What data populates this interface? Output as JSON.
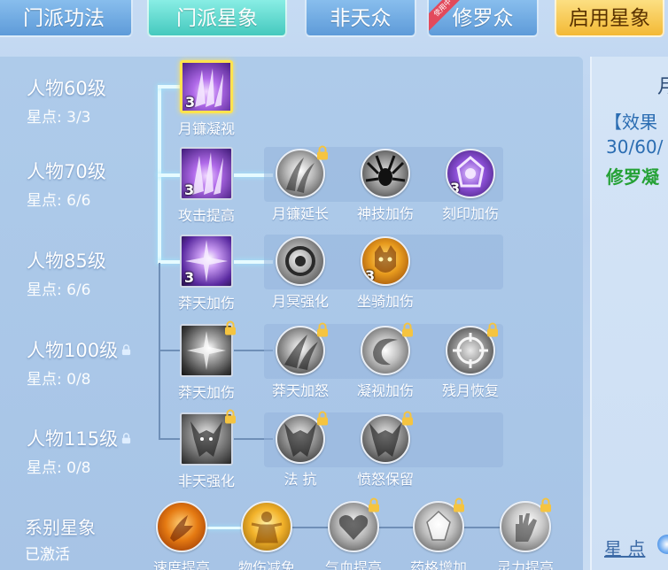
{
  "tabs": [
    {
      "label": "门派功法",
      "state": "normal"
    },
    {
      "label": "门派星象",
      "state": "active"
    },
    {
      "label": "非天众",
      "state": "normal"
    },
    {
      "label": "修罗众",
      "state": "normal",
      "ribbon": "使用中"
    },
    {
      "label": "启用星象",
      "state": "action"
    }
  ],
  "levels": [
    {
      "title": "人物60级",
      "stars": "星点: 3/3",
      "locked": false
    },
    {
      "title": "人物70级",
      "stars": "星点: 6/6",
      "locked": false
    },
    {
      "title": "人物85级",
      "stars": "星点: 6/6",
      "locked": false
    },
    {
      "title": "人物100级",
      "stars": "星点: 0/8",
      "locked": true
    },
    {
      "title": "人物115级",
      "stars": "星点: 0/8",
      "locked": true
    }
  ],
  "skills": {
    "r0": [
      {
        "label": "月镰凝视",
        "level": "3",
        "locked": false,
        "icon": "purple-claw-icon",
        "selected": true
      }
    ],
    "r1": [
      {
        "label": "攻击提高",
        "level": "3",
        "locked": false,
        "icon": "purple-claw-icon"
      },
      {
        "label": "月镰延长",
        "level": "",
        "locked": true,
        "icon": "grey-claw-icon"
      },
      {
        "label": "神技加伤",
        "level": "",
        "locked": false,
        "icon": "grey-spider-icon"
      },
      {
        "label": "刻印加伤",
        "level": "3",
        "locked": false,
        "icon": "purple-seal-icon"
      }
    ],
    "r2": [
      {
        "label": "莽天加伤",
        "level": "3",
        "locked": false,
        "icon": "purple-burst-icon"
      },
      {
        "label": "月冥强化",
        "level": "",
        "locked": false,
        "icon": "grey-moon-icon"
      },
      {
        "label": "坐骑加伤",
        "level": "3",
        "locked": false,
        "icon": "gold-beast-icon"
      }
    ],
    "r3": [
      {
        "label": "莽天加伤",
        "level": "",
        "locked": true,
        "icon": "grey-burst-icon"
      },
      {
        "label": "莽天加怒",
        "level": "",
        "locked": true,
        "icon": "grey-claw-icon"
      },
      {
        "label": "凝视加伤",
        "level": "",
        "locked": true,
        "icon": "grey-swirl-icon"
      },
      {
        "label": "残月恢复",
        "level": "",
        "locked": true,
        "icon": "grey-ring-icon"
      }
    ],
    "r4": [
      {
        "label": "非天强化",
        "level": "",
        "locked": true,
        "icon": "grey-demon-icon"
      },
      {
        "label": "法 抗",
        "level": "",
        "locked": true,
        "icon": "grey-demon-icon"
      },
      {
        "label": "愤怒保留",
        "level": "",
        "locked": true,
        "icon": "grey-demon-icon"
      }
    ]
  },
  "series": {
    "title": "系别星象",
    "status": "已激活",
    "items": [
      {
        "label": "速度提高",
        "locked": false,
        "icon": "orange-speed-icon"
      },
      {
        "label": "物伤减免",
        "locked": false,
        "icon": "gold-figure-icon"
      },
      {
        "label": "气血提高",
        "locked": true,
        "icon": "grey-heart-icon"
      },
      {
        "label": "药格增加",
        "locked": true,
        "icon": "grey-crystal-icon"
      },
      {
        "label": "灵力提高",
        "locked": true,
        "icon": "grey-hand-icon"
      }
    ]
  },
  "right_panel": {
    "title_fragment": "月",
    "effect_label": "【效果",
    "values": "30/60/",
    "skill_fragment": "修罗凝",
    "star_points_label": "星 点"
  },
  "colors": {
    "panel": "#a7c4e6",
    "active_tab": "#45c9be",
    "gold_tab": "#f3b935",
    "lit_connector": "#e6fbff",
    "effect_blue": "#2b6db2",
    "skill_green": "#25a136"
  }
}
